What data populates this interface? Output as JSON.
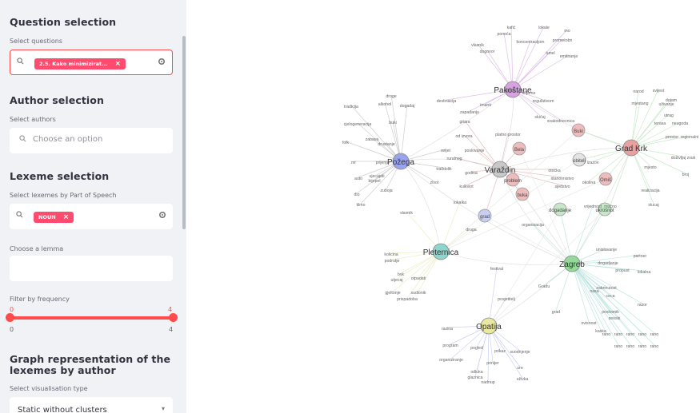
{
  "sidebar": {
    "question_section": {
      "title": "Question selection",
      "label": "Select questions",
      "selected": "2.5. Kako minimizirat...",
      "icons": [
        "search-icon",
        "close-icon",
        "settings-icon"
      ]
    },
    "author_section": {
      "title": "Author selection",
      "label": "Select authors",
      "placeholder": "Choose an option"
    },
    "lexeme_section": {
      "title": "Lexeme selection",
      "pos_label": "Select lexemes by Part of Speech",
      "pos_selected": "NOUN",
      "lemma_label": "Choose a lemma",
      "lemma_value": ""
    },
    "frequency": {
      "label": "Filter by frequency",
      "range_min": "0",
      "range_max": "4",
      "bound_min": "0",
      "bound_max": "4",
      "selected_fraction": [
        0,
        1
      ]
    },
    "graph_section": {
      "title_line1": "Graph representation of the",
      "title_line2": "lexemes by author",
      "select_label": "Select visualisation type",
      "select_value": "Static without clusters"
    }
  },
  "graph": {
    "authors": [
      {
        "label": "Pakoštane",
        "color": "#d6a3e0"
      },
      {
        "label": "Požega",
        "color": "#9aa4ee"
      },
      {
        "label": "Varaždin",
        "color": "#c8c8c8"
      },
      {
        "label": "Grad Krk",
        "color": "#e8a0a0"
      },
      {
        "label": "Zagreb",
        "color": "#93d99a"
      },
      {
        "label": "Pleternica",
        "color": "#8ed6cc"
      },
      {
        "label": "Opatija",
        "color": "#e8e8a0"
      }
    ],
    "mid_nodes": [
      {
        "label": "Bela",
        "color": "#eebcbc"
      },
      {
        "label": "problem",
        "color": "#eebcbc"
      },
      {
        "label": "buka",
        "color": "#eebcbc"
      },
      {
        "label": "Omiš",
        "color": "#eebcbc"
      },
      {
        "label": "Buki",
        "color": "#eebcbc"
      },
      {
        "label": "dogadanje",
        "color": "#c6e8c8"
      },
      {
        "label": "grad",
        "color": "#c9cdf2"
      },
      {
        "label": "obitelj",
        "color": "#e4e4e4"
      },
      {
        "label": "ukrošnot",
        "color": "#c6e8c8"
      }
    ],
    "words": [
      "kafić",
      "lokale",
      "mo",
      "ponoća",
      "koncentracijom",
      "prometobn",
      "vlasnik",
      "dogovor",
      "tunel",
      "emitiranje",
      "odnos",
      "vrijeme",
      "regulativom",
      "droge",
      "destinacija",
      "zapadanju",
      "imanti",
      "tradicija",
      "alkohol",
      "dogadaj",
      "gitara",
      "slučaj",
      "svakodnevnica",
      "cjelogeneracija",
      "buki",
      "od izvora",
      "platno prostor",
      "folk",
      "zabava",
      "drustanje",
      "stanovnistvo",
      "svijet",
      "poslovanje",
      "ruralnog",
      "godina",
      "izazov",
      "mr",
      "prijenja",
      "ujecajati",
      "otočka",
      "auto",
      "bijepel",
      "zuboja",
      "sjedstvo",
      "okolina",
      "trašdolik",
      "zivot",
      "kulkviot",
      "lokalka",
      "dio",
      "tilmo",
      "slavnik",
      "organizacija",
      "druga",
      "vrijednost",
      "mučno",
      "narod",
      "svijest",
      "mjestang",
      "uživanje",
      "dojam",
      "utrag",
      "terasa",
      "neugoda",
      "prostor",
      "regionalni",
      "doživljaj zvuk",
      "mjesto",
      "broj",
      "realizacija",
      "slucaj",
      "kolicina",
      "podrutje",
      "bvk",
      "utjecaj",
      "otpadati",
      "gjeltonje",
      "sudionik",
      "prispadoba",
      "festival",
      "unistavanje",
      "dogadjanje",
      "partner",
      "posjetitelj",
      "propust",
      "lokalna",
      "Gradu",
      "nasa",
      "zabrinutost",
      "grad",
      "ceca",
      "razor",
      "poslovnik",
      "seoski",
      "ovisnost",
      "kaska",
      "razina",
      "program",
      "pogled",
      "prikaz",
      "suodnjenje",
      "organiziranje",
      "prinijer",
      "ure",
      "odluka",
      "glaznica",
      "nadnup",
      "uživka",
      "rano",
      "rano",
      "rano",
      "rano",
      "rano",
      "rano",
      "rano",
      "rano",
      "rano"
    ]
  }
}
